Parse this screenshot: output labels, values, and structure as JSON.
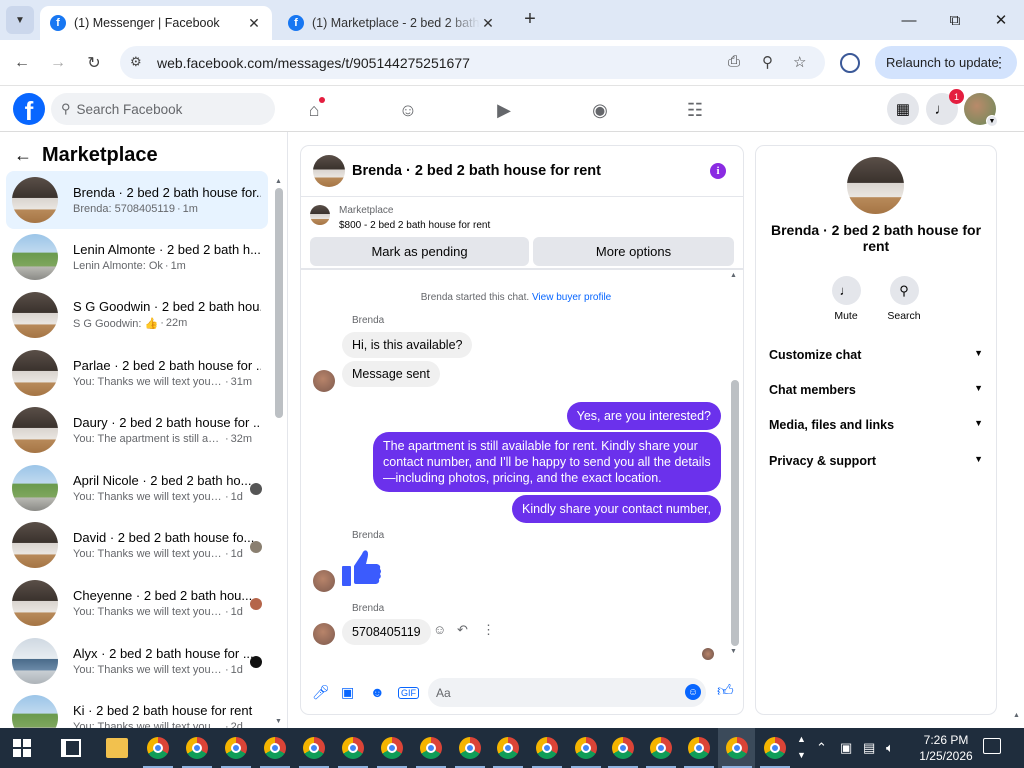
{
  "browser": {
    "tabs": [
      {
        "title": "(1) Messenger | Facebook",
        "active": true
      },
      {
        "title": "(1) Marketplace - 2 bed 2 bath house",
        "active": false
      }
    ],
    "url": "web.facebook.com/messages/t/905144275251677",
    "relaunch_label": "Relaunch to update"
  },
  "fb": {
    "search_placeholder": "Search Facebook",
    "notification_count": "1"
  },
  "marketplace": {
    "title": "Marketplace",
    "conversations": [
      {
        "name": "Brenda · 2 bed 2 bath house for...",
        "preview": "Brenda: 5708405119",
        "time": "1m",
        "thumb": "kitchen",
        "selected": true
      },
      {
        "name": "Lenin Almonte · 2 bed 2 bath h...",
        "preview": "Lenin Almonte: Ok",
        "time": "1m",
        "thumb": "house"
      },
      {
        "name": "S G Goodwin · 2 bed 2 bath hou...",
        "preview": "S G Goodwin: 👍",
        "time": "22m",
        "thumb": "kitchen"
      },
      {
        "name": "Parlae · 2 bed 2 bath house for ...",
        "preview": "You: Thanks we will text you soon",
        "time": "31m",
        "thumb": "kitchen"
      },
      {
        "name": "Daury · 2 bed 2 bath house for ...",
        "preview": "You: The apartment is still availa...",
        "time": "32m",
        "thumb": "kitchen"
      },
      {
        "name": "April Nicole · 2 bed 2 bath ho...",
        "preview": "You: Thanks we will text you soon",
        "time": "1d",
        "thumb": "house",
        "seen": "#555"
      },
      {
        "name": "David · 2 bed 2 bath house fo...",
        "preview": "You: Thanks we will text you soon",
        "time": "1d",
        "thumb": "kitchen",
        "seen": "#8a7f70"
      },
      {
        "name": "Cheyenne · 2 bed 2 bath hou...",
        "preview": "You: Thanks we will text you soon",
        "time": "1d",
        "thumb": "kitchen",
        "seen": "#b5654a"
      },
      {
        "name": "Alyx · 2 bed 2 bath house for ...",
        "preview": "You: Thanks we will text you soon",
        "time": "1d",
        "thumb": "office",
        "seen": "#111"
      },
      {
        "name": "Ki · 2 bed 2 bath house for rent",
        "preview": "You: Thanks we will text you soon",
        "time": "2d",
        "thumb": "house"
      }
    ]
  },
  "chat": {
    "title": "Brenda · 2 bed 2 bath house for rent",
    "listing_source": "Marketplace",
    "listing": "$800 - 2 bed 2 bath house for rent",
    "btn_pending": "Mark as pending",
    "btn_more": "More options",
    "system_text": "Brenda started this chat.",
    "system_link": "View buyer profile",
    "sender": "Brenda",
    "msg1": "Hi, is this available?",
    "msg2": "Message sent",
    "out1": "Yes, are you interested?",
    "out2": "The apartment is still available for rent. Kindly share your contact number, and I'll be happy to send you all the details—including photos, pricing, and the exact location.",
    "out3": "Kindly share your contact number,",
    "msg4": "5708405119",
    "composer_placeholder": "Aa"
  },
  "details": {
    "name": "Brenda · 2 bed 2 bath house for rent",
    "mute": "Mute",
    "search": "Search",
    "sections": [
      "Customize chat",
      "Chat members",
      "Media, files and links",
      "Privacy & support"
    ]
  },
  "taskbar": {
    "time": "7:26 PM",
    "date": "1/25/2026"
  },
  "colors": {
    "accent": "#0866ff",
    "outgoing_bubble": "#6b31ec",
    "selected_row": "#e7f3ff"
  }
}
